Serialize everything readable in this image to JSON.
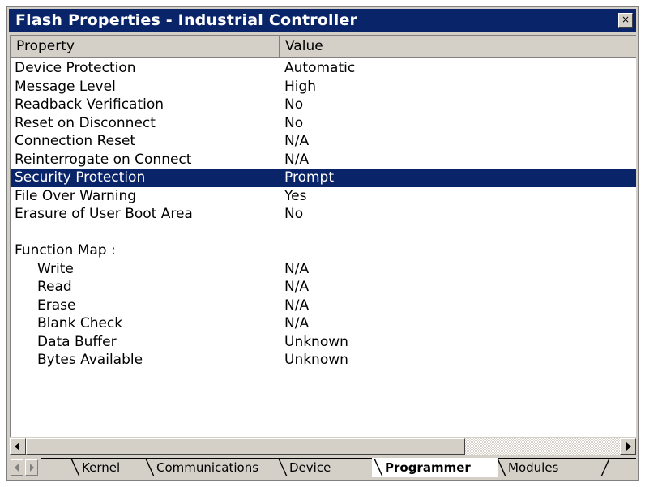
{
  "window": {
    "title": "Flash Properties - Industrial Controller",
    "close_glyph": "×"
  },
  "columns": {
    "property": "Property",
    "value": "Value"
  },
  "rows": [
    {
      "property": "Device Protection",
      "value": "Automatic"
    },
    {
      "property": "Message Level",
      "value": "High"
    },
    {
      "property": "Readback Verification",
      "value": "No"
    },
    {
      "property": "Reset on Disconnect",
      "value": "No"
    },
    {
      "property": "Connection Reset",
      "value": "N/A"
    },
    {
      "property": "Reinterrogate on Connect",
      "value": "N/A"
    },
    {
      "property": "Security Protection",
      "value": "Prompt",
      "selected": true
    },
    {
      "property": "File Over Warning",
      "value": "Yes"
    },
    {
      "property": "Erasure of User Boot Area",
      "value": "No"
    },
    {
      "property": "",
      "value": ""
    },
    {
      "property": "Function Map :",
      "value": ""
    },
    {
      "property": "Write",
      "value": "N/A",
      "indent": true
    },
    {
      "property": "Read",
      "value": "N/A",
      "indent": true
    },
    {
      "property": "Erase",
      "value": "N/A",
      "indent": true
    },
    {
      "property": "Blank Check",
      "value": "N/A",
      "indent": true
    },
    {
      "property": "Data Buffer",
      "value": "Unknown",
      "indent": true
    },
    {
      "property": "Bytes Available",
      "value": "Unknown",
      "indent": true
    }
  ],
  "tabs": [
    {
      "label": "Kernel",
      "active": false
    },
    {
      "label": "Communications",
      "active": false
    },
    {
      "label": "Device",
      "active": false
    },
    {
      "label": "Programmer",
      "active": true
    },
    {
      "label": "Modules",
      "active": false
    }
  ],
  "colors": {
    "titlebar": "#0a246a",
    "selection": "#0a246a",
    "chrome": "#d4d0c8"
  },
  "icons": [
    "close-icon",
    "scroll-left-icon",
    "scroll-right-icon",
    "tab-prev-icon",
    "tab-next-icon"
  ]
}
